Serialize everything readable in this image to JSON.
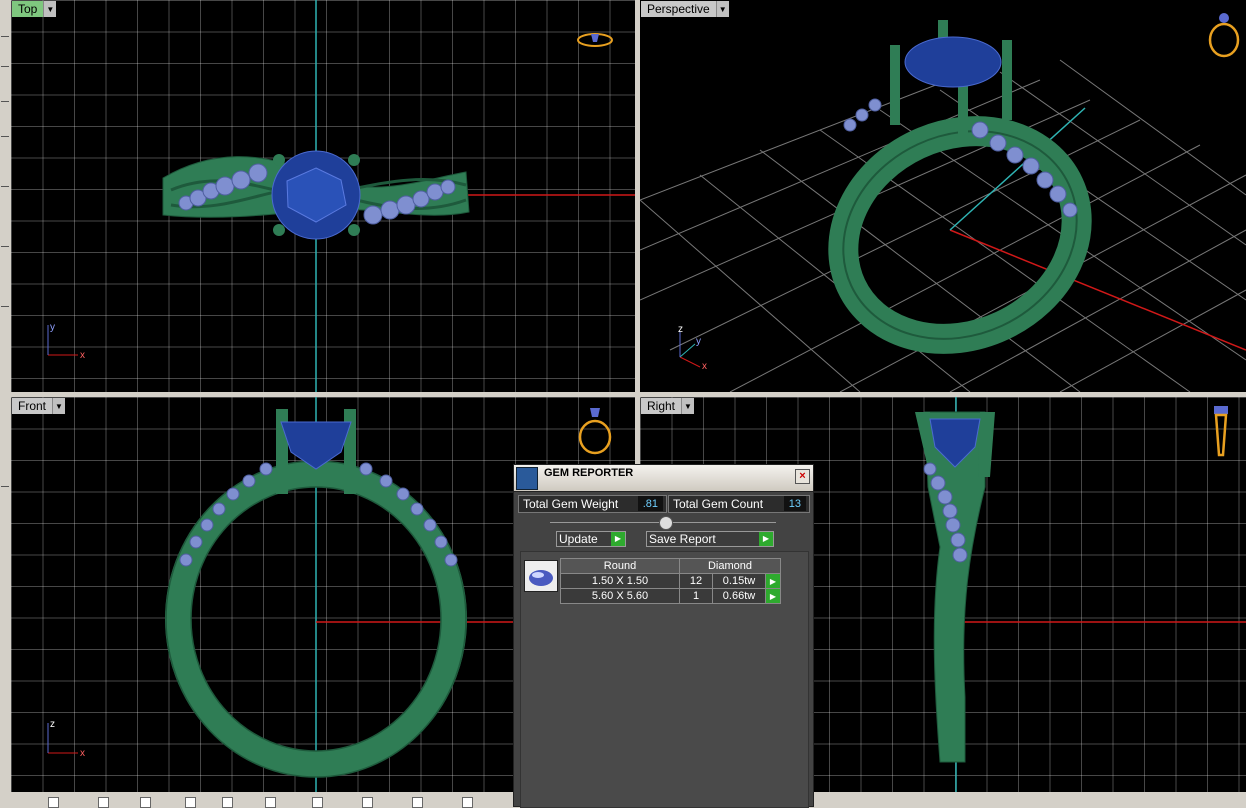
{
  "viewports": {
    "top": {
      "label": "Top"
    },
    "perspective": {
      "label": "Perspective"
    },
    "front": {
      "label": "Front"
    },
    "right": {
      "label": "Right"
    }
  },
  "axes": {
    "x": "x",
    "y": "y",
    "z": "z"
  },
  "gem_reporter": {
    "title": "GEM REPORTER",
    "total_weight_label": "Total Gem Weight",
    "total_weight_value": ".81",
    "total_count_label": "Total Gem Count",
    "total_count_value": "13",
    "update_label": "Update",
    "save_report_label": "Save Report",
    "table": {
      "header_shape": "Round",
      "header_material": "Diamond",
      "rows": [
        {
          "size": "1.50 X 1.50",
          "count": "12",
          "weight": "0.15tw"
        },
        {
          "size": "5.60 X 5.60",
          "count": "1",
          "weight": "0.66tw"
        }
      ]
    }
  },
  "colors": {
    "metal": "#2f7d55",
    "stone_center": "#1f3f9a",
    "stone_side": "#7f8fd0",
    "axis_x": "#d01818",
    "axis_y": "#2fb3b3",
    "active_label": "#7fc77f"
  }
}
